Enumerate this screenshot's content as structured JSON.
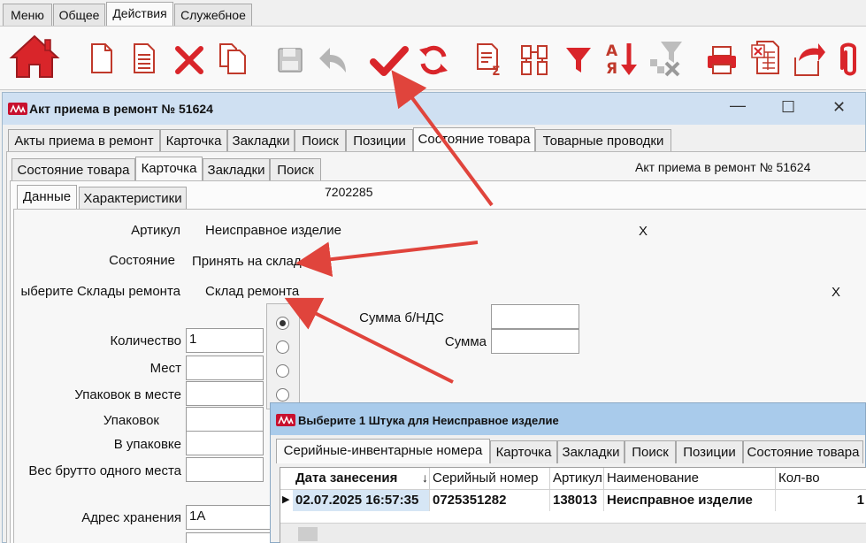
{
  "menu_tabs": [
    {
      "label": "Меню"
    },
    {
      "label": "Общее"
    },
    {
      "label": "Действия",
      "active": true
    },
    {
      "label": "Служебное"
    }
  ],
  "colors": {
    "brand_red": "#d9252a",
    "title_bar": "#cfe0f2",
    "popup_title_bar": "#a9cbeb",
    "arrow": "#e0443c"
  },
  "toolbar_icons": [
    "home-icon",
    "new-document-icon",
    "document-list-icon",
    "delete-icon",
    "copy-icon",
    "save-icon",
    "undo-icon",
    "confirm-check-icon",
    "refresh-icon",
    "calc-sum-icon",
    "tree-icon",
    "filter-icon",
    "sort-icon",
    "clear-filter-icon",
    "print-icon",
    "excel-export-icon",
    "export-icon",
    "attach-icon"
  ],
  "window": {
    "title": "Акт приема в ремонт № 51624",
    "controls": {
      "minimize": "—",
      "maximize": "☐",
      "close": "✕"
    },
    "tabs": [
      "Акты приема в ремонт",
      "Карточка",
      "Закладки",
      "Поиск",
      "Позиции",
      "Состояние товара",
      "Товарные проводки"
    ],
    "subtabs": [
      "Состояние товара",
      "Карточка",
      "Закладки",
      "Поиск"
    ],
    "doc_header": "Акт приема в ремонт № 51624",
    "inner_tabs": [
      "Данные",
      "Характеристики"
    ],
    "code": "7202285",
    "rows": {
      "article_label": "Артикул",
      "article_value": "Неисправное изделие",
      "article_x": "X",
      "state_label": "Состояние",
      "state_value": "Принять на склад",
      "warehouse_label": "ыберите Склады ремонта",
      "warehouse_value": "Склад ремонта",
      "warehouse_x": "X"
    },
    "fields": [
      {
        "label": "Количество",
        "value": "1"
      },
      {
        "label": "Мест",
        "value": ""
      },
      {
        "label": "Упаковок в месте",
        "value": ""
      },
      {
        "label": "Упаковок",
        "value": ""
      },
      {
        "label": "В упаковке",
        "value": ""
      },
      {
        "label": "Вес брутто одного места",
        "value": ""
      },
      {
        "label": "Адрес хранения",
        "value": "1А"
      }
    ],
    "sum_fields": [
      {
        "label": "Сумма  б/НДС",
        "value": ""
      },
      {
        "label": "Сумма",
        "value": ""
      }
    ]
  },
  "popup": {
    "title": "Выберите 1 Штука для Неисправное изделие",
    "tabs": [
      "Серийные-инвентарные номера",
      "Карточка",
      "Закладки",
      "Поиск",
      "Позиции",
      "Состояние товара"
    ],
    "columns": [
      "Дата занесения",
      "Серийный номер",
      "Артикул",
      "Наименование",
      "Кол-во"
    ],
    "row": {
      "date": "02.07.2025 16:57:35",
      "serial": "0725351282",
      "article": "138013",
      "name": "Неисправное изделие",
      "qty": "1"
    }
  }
}
